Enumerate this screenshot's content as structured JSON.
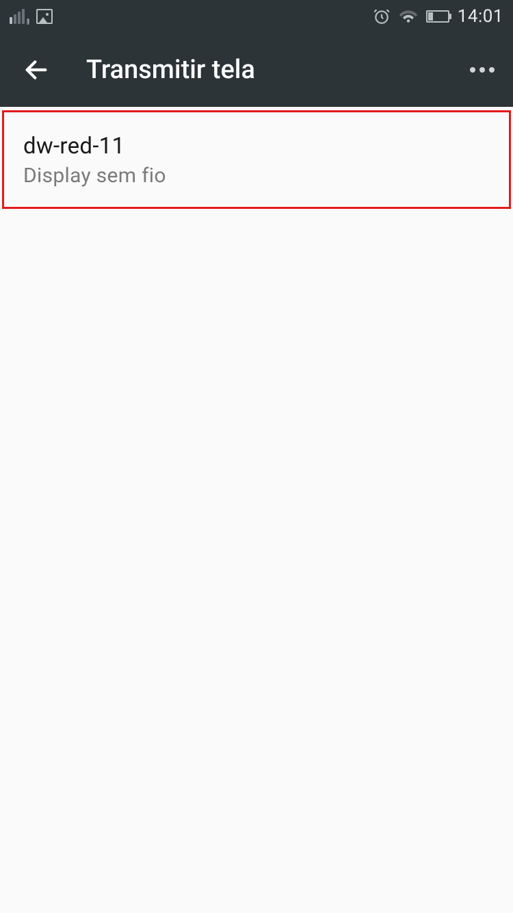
{
  "status_bar": {
    "signal_sub": "1",
    "time": "14:01"
  },
  "header": {
    "title": "Transmitir tela"
  },
  "devices": [
    {
      "name": "dw-red-11",
      "subtitle": "Display sem fio"
    }
  ]
}
